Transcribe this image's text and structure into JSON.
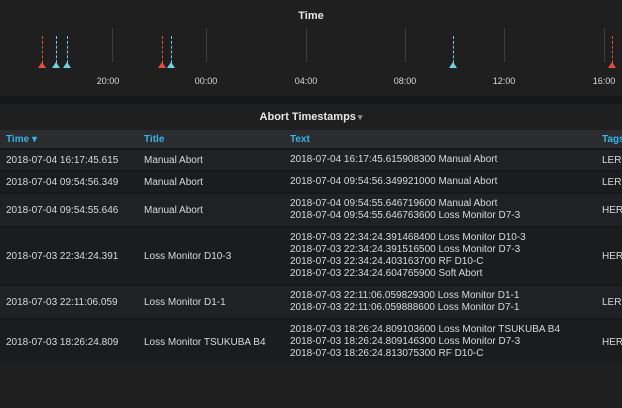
{
  "timeline": {
    "title": "Time",
    "ticks": [
      "20:00",
      "00:00",
      "04:00",
      "08:00",
      "12:00",
      "16:00"
    ],
    "colors": {
      "loss": "#e24d42",
      "abort": "#6ed0e0",
      "grid": "#3c3d40"
    }
  },
  "table": {
    "title": "Abort Timestamps",
    "caret_icon": "chevron-down-icon",
    "columns": {
      "time": "Time",
      "time_sort_icon": "sort-desc-icon",
      "title": "Title",
      "text": "Text",
      "tags": "Tags"
    },
    "header_color": "#33b5e5",
    "rows": [
      {
        "time": "2018-07-04 16:17:45.615",
        "title": "Manual Abort",
        "text": [
          "2018-07-04 16:17:45.615908300 Manual Abort"
        ],
        "tags": "LER"
      },
      {
        "time": "2018-07-04 09:54:56.349",
        "title": "Manual Abort",
        "text": [
          "2018-07-04 09:54:56.349921000 Manual Abort"
        ],
        "tags": "LER"
      },
      {
        "time": "2018-07-04 09:54:55.646",
        "title": "Manual Abort",
        "text": [
          "2018-07-04 09:54:55.646719600 Manual Abort",
          "2018-07-04 09:54:55.646763600 Loss Monitor D7-3"
        ],
        "tags": "HER"
      },
      {
        "time": "2018-07-03 22:34:24.391",
        "title": "Loss Monitor D10-3",
        "text": [
          "2018-07-03 22:34:24.391468400 Loss Monitor D10-3",
          "2018-07-03 22:34:24.391516500 Loss Monitor D7-3",
          "2018-07-03 22:34:24.403163700 RF D10-C",
          "2018-07-03 22:34:24.604765900 Soft Abort"
        ],
        "tags": "HER"
      },
      {
        "time": "2018-07-03 22:11:06.059",
        "title": "Loss Monitor D1-1",
        "text": [
          "2018-07-03 22:11:06.059829300 Loss Monitor D1-1",
          "2018-07-03 22:11:06.059888600 Loss Monitor D7-1"
        ],
        "tags": "LER"
      },
      {
        "time": "2018-07-03 18:26:24.809",
        "title": "Loss Monitor TSUKUBA B4",
        "text": [
          "2018-07-03 18:26:24.809103600 Loss Monitor TSUKUBA B4",
          "2018-07-03 18:26:24.809146300 Loss Monitor D7-3",
          "2018-07-03 18:26:24.813075300 RF D10-C"
        ],
        "tags": "HER"
      }
    ]
  }
}
